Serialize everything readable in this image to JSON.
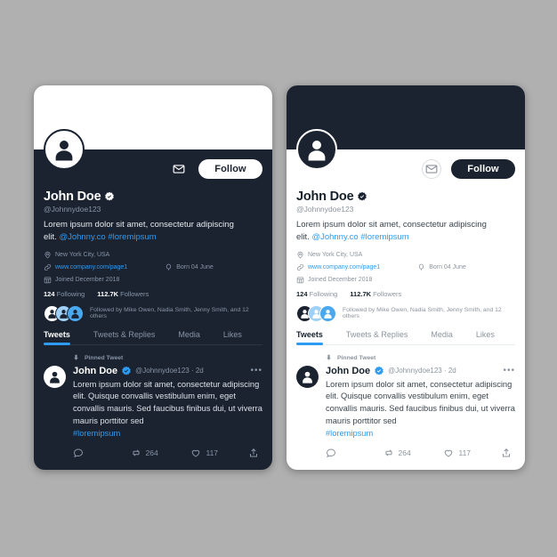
{
  "page": {
    "background_color": "#b0b0b0",
    "accent_blue": "#2f9bf0",
    "dark_navy": "#1b2331"
  },
  "profile": {
    "display_name": "John Doe",
    "handle": "@Johnnydoe123",
    "verified_icon": "verified-badge-icon",
    "avatar_icon": "user-avatar-icon",
    "mail_icon": "mail-envelope-icon",
    "follow_label": "Follow",
    "bio_text": "Lorem ipsum dolor sit amet, consectetur adipiscing elit. ",
    "bio_mention": "@Johnny.co",
    "bio_hashtag": "#loremipsum",
    "meta": {
      "location_icon": "location-pin-icon",
      "location": "New York City, USA",
      "link_icon": "link-icon",
      "website": "www.company.com/page1",
      "birthday_icon": "balloon-icon",
      "birthday": "Born 04 June",
      "joined_icon": "calendar-icon",
      "joined": "Joined December 2018"
    },
    "stats": {
      "following_count": "124",
      "following_label": "Following",
      "followers_count": "112.7K",
      "followers_label": "Followers"
    },
    "followed_by": "Followed by Mike Owen, Nadia Smith, Jenny Smith, and 12 others"
  },
  "tabs": [
    {
      "label": "Tweets",
      "active": true
    },
    {
      "label": "Tweets & Replies",
      "active": false
    },
    {
      "label": "Media",
      "active": false
    },
    {
      "label": "Likes",
      "active": false
    }
  ],
  "tweet": {
    "pinned_icon": "pin-icon",
    "pinned_label": "Pinned Tweet",
    "avatar_icon": "user-avatar-icon",
    "author_name": "John Doe",
    "verified_icon": "verified-badge-icon",
    "handle_and_time": "@Johnnydoe123 · 2d",
    "more_icon": "more-options-icon",
    "text": "Lorem ipsum dolor sit amet, consectetur adipiscing elit. Quisque convallis vestibulum enim, eget convallis mauris. Sed faucibus finibus dui, ut viverra mauris porttitor sed",
    "hashtag": "#loremipsum",
    "actions": {
      "reply_icon": "comment-icon",
      "reply_count": "",
      "retweet_icon": "retweet-icon",
      "retweet_count": "264",
      "like_icon": "heart-icon",
      "like_count": "117",
      "share_icon": "share-icon"
    }
  }
}
